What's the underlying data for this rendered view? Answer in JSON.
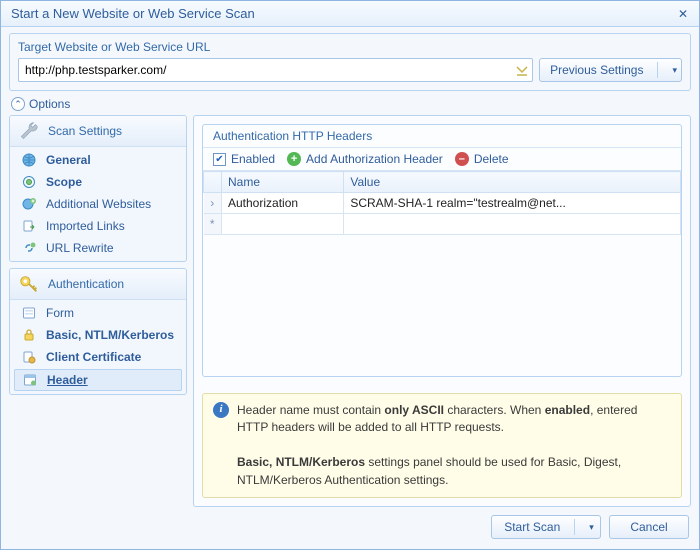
{
  "titlebar": {
    "title": "Start a New Website or Web Service Scan",
    "close_glyph": "✕"
  },
  "target": {
    "label": "Target Website or Web Service URL",
    "url": "http://php.testsparker.com/",
    "prev_btn": "Previous Settings"
  },
  "options": {
    "label": "Options",
    "toggle_glyph": "⌃"
  },
  "sidebar": {
    "scan": {
      "title": "Scan Settings",
      "items": [
        {
          "label": "General",
          "icon": "globe",
          "bold": true
        },
        {
          "label": "Scope",
          "icon": "target",
          "bold": true
        },
        {
          "label": "Additional Websites",
          "icon": "globe-plus",
          "bold": false
        },
        {
          "label": "Imported Links",
          "icon": "doc-import",
          "bold": false
        },
        {
          "label": "URL Rewrite",
          "icon": "link-rewrite",
          "bold": false
        }
      ]
    },
    "auth": {
      "title": "Authentication",
      "items": [
        {
          "label": "Form",
          "icon": "form"
        },
        {
          "label": "Basic, NTLM/Kerberos",
          "icon": "lock",
          "bold": true
        },
        {
          "label": "Client Certificate",
          "icon": "cert",
          "bold": true
        },
        {
          "label": "Header",
          "icon": "header",
          "bold": true,
          "active": true
        }
      ]
    }
  },
  "main": {
    "title": "Authentication HTTP Headers",
    "enabled_label": "Enabled",
    "add_label": "Add Authorization Header",
    "delete_label": "Delete",
    "columns": {
      "name": "Name",
      "value": "Value"
    },
    "rows": [
      {
        "name": "Authorization",
        "value": "SCRAM-SHA-1 realm=\"testrealm@net..."
      }
    ],
    "info_html": "Header name must contain <b>only ASCII</b> characters. When <b>enabled</b>, entered HTTP headers will be added to all HTTP requests.<br><br><b>Basic, NTLM/Kerberos</b> settings panel should be used for Basic, Digest, NTLM/Kerberos Authentication settings."
  },
  "footer": {
    "start": "Start Scan",
    "cancel": "Cancel"
  }
}
